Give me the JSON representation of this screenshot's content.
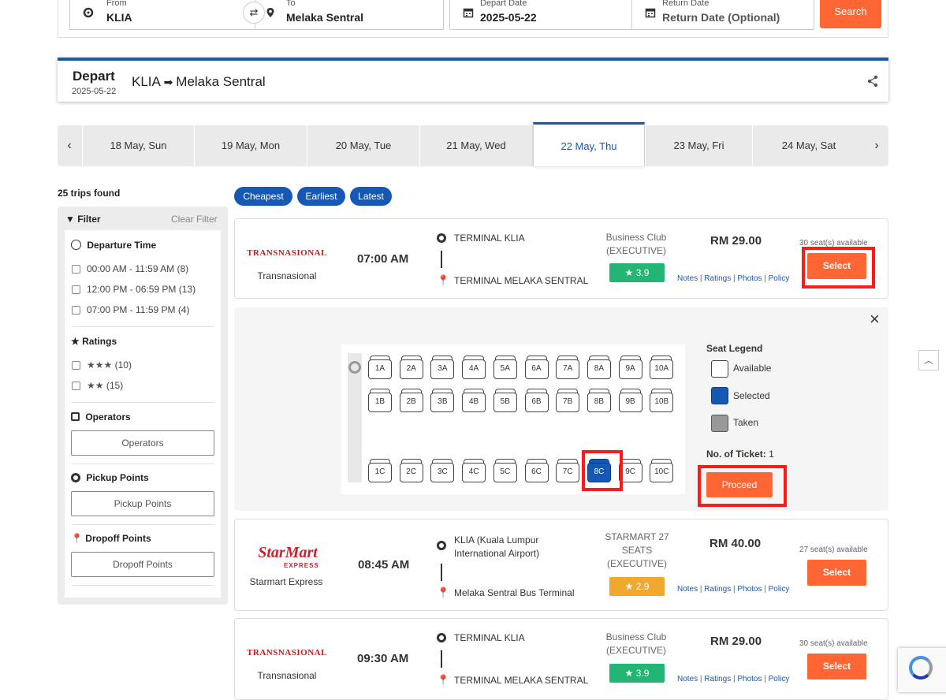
{
  "search": {
    "from_label": "From",
    "from_value": "KLIA",
    "to_label": "To",
    "to_value": "Melaka Sentral",
    "depart_label": "Depart Date",
    "depart_value": "2025-05-22",
    "return_label": "Return Date",
    "return_value": "Return Date (Optional)",
    "search_button": "Search"
  },
  "depart": {
    "title": "Depart",
    "date": "2025-05-22",
    "origin": "KLIA",
    "destination": "Melaka Sentral"
  },
  "dates": [
    "18 May, Sun",
    "19 May, Mon",
    "20 May, Tue",
    "21 May, Wed",
    "22 May, Thu",
    "23 May, Fri",
    "24 May, Sat"
  ],
  "active_date_index": 4,
  "sidebar": {
    "trips_found": "25 trips found",
    "filter_title": "Filter",
    "clear_filter": "Clear Filter",
    "departure_time_title": "Departure Time",
    "departure_times": [
      "00:00 AM - 11:59 AM (8)",
      "12:00 PM - 06:59 PM (13)",
      "07:00 PM - 11:59 PM (4)"
    ],
    "ratings_title": "Ratings",
    "ratings": [
      {
        "stars": 3,
        "count": "(10)"
      },
      {
        "stars": 2,
        "count": "(15)"
      }
    ],
    "operators_title": "Operators",
    "operators_button": "Operators",
    "pickup_title": "Pickup Points",
    "pickup_button": "Pickup Points",
    "dropoff_title": "Dropoff Points",
    "dropoff_button": "Dropoff Points"
  },
  "sort": [
    "Cheapest",
    "Earliest",
    "Latest"
  ],
  "trips": [
    {
      "logo_text": "TRANSNASIONAL",
      "operator": "Transnasional",
      "time": "07:00 AM",
      "from": "TERMINAL KLIA",
      "to": "TERMINAL MELAKA SENTRAL",
      "class": "Business Club (EXECUTIVE)",
      "rating": "3.9",
      "rating_color": "#22b573",
      "price": "RM 29.00",
      "seats": "30 seat(s) available",
      "select": "Select"
    },
    {
      "logo_text": "StarMart",
      "logo_sub": "EXPRESS",
      "operator": "Starmart Express",
      "time": "08:45 AM",
      "from": "KLIA (Kuala Lumpur International Airport)",
      "to": "Melaka Sentral Bus Terminal",
      "class": "STARMART 27 SEATS (EXECUTIVE)",
      "rating": "2.9",
      "rating_color": "#f0a830",
      "price": "RM 40.00",
      "seats": "27 seat(s) available",
      "select": "Select"
    },
    {
      "logo_text": "TRANSNASIONAL",
      "operator": "Transnasional",
      "time": "09:30 AM",
      "from": "TERMINAL KLIA",
      "to": "TERMINAL MELAKA SENTRAL",
      "class": "Business Club (EXECUTIVE)",
      "rating": "3.9",
      "rating_color": "#22b573",
      "price": "RM 29.00",
      "seats": "30 seat(s) available",
      "select": "Select"
    }
  ],
  "links": [
    "Notes",
    "Ratings",
    "Photos",
    "Policy"
  ],
  "seat_map": {
    "row_a": [
      "1A",
      "2A",
      "3A",
      "4A",
      "5A",
      "6A",
      "7A",
      "8A",
      "9A",
      "10A"
    ],
    "row_b": [
      "1B",
      "2B",
      "3B",
      "4B",
      "5B",
      "6B",
      "7B",
      "8B",
      "9B",
      "10B"
    ],
    "row_c": [
      "1C",
      "2C",
      "3C",
      "4C",
      "5C",
      "6C",
      "7C",
      "8C",
      "9C",
      "10C"
    ],
    "selected": "8C"
  },
  "legend": {
    "title": "Seat Legend",
    "available": "Available",
    "selected": "Selected",
    "taken": "Taken",
    "ticket_label": "No. of Ticket:",
    "ticket_count": "1",
    "proceed": "Proceed"
  },
  "colors": {
    "accent_blue": "#1659b5",
    "action_orange": "#ff6633",
    "highlight_red": "#ff1a1a"
  }
}
